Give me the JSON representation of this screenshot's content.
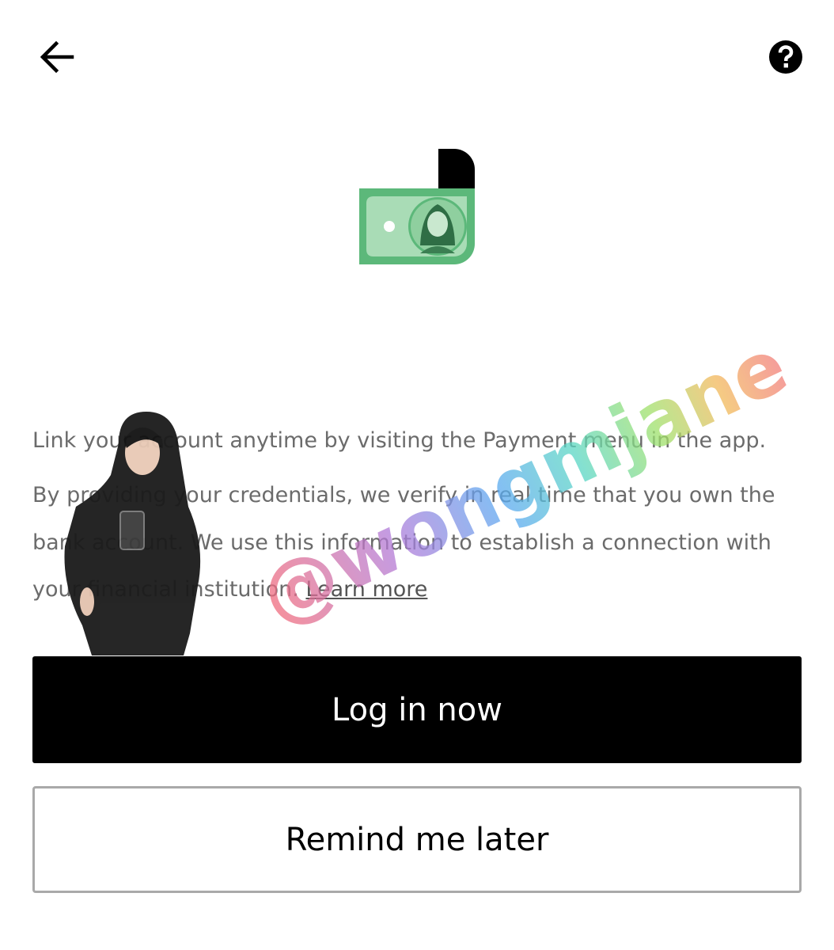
{
  "header": {
    "back_icon": "arrow-left-icon",
    "help_icon": "question-circle-icon"
  },
  "hero": {
    "icon": "cash-banknote-icon",
    "colors": {
      "banknote": "#5cb87a",
      "banknote_light": "#a9dcb6",
      "tab": "#000000"
    }
  },
  "content": {
    "paragraph_1": "Link your account anytime by visiting the Payment menu in the app.",
    "paragraph_2": "By providing your credentials, we verify in real time that you own the bank account. We use this information to establish a connection with your financial institution.",
    "learn_more": "Learn more"
  },
  "actions": {
    "primary_label": "Log in now",
    "secondary_label": "Remind me later"
  },
  "overlay": {
    "watermark_text": "@wongmjane",
    "watermark_colors": [
      "#f26b7a",
      "#b07ad9",
      "#5aa8f0",
      "#59d6c4",
      "#9ee06a",
      "#f2b85a",
      "#f27a7a"
    ]
  }
}
